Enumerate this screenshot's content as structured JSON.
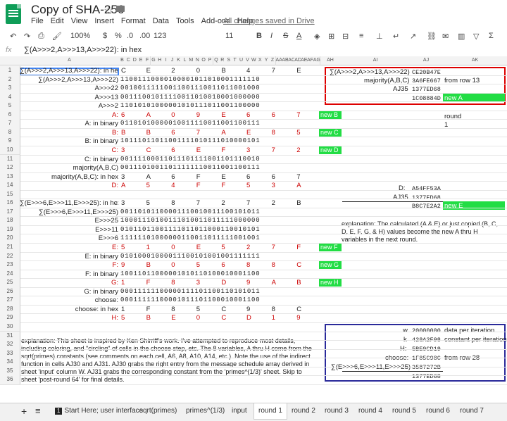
{
  "app": {
    "doc_title": "Copy of SHA-256",
    "menu": [
      "File",
      "Edit",
      "View",
      "Insert",
      "Format",
      "Data",
      "Tools",
      "Add-ons",
      "Help"
    ],
    "saved_status": "All changes saved in Drive"
  },
  "toolbar": {
    "zoom": "100%",
    "currency": "$",
    "percent": "%",
    "dec_less": ".0",
    "dec_more": ".00",
    "format_more": "123",
    "font_size": "11"
  },
  "formula_bar": {
    "fx": "fx",
    "content": "∑(A>>>2,A>>>13,A>>>22): in hex"
  },
  "columns": {
    "a": "A",
    "bits": [
      "B",
      "C",
      "D",
      "E",
      "F",
      "G",
      "H",
      "I",
      "J",
      "K",
      "L",
      "M",
      "N",
      "O",
      "P",
      "Q",
      "R",
      "S",
      "T",
      "U",
      "V",
      "W",
      "X",
      "Y",
      "Z",
      "AA",
      "AB",
      "AC",
      "AD",
      "AE",
      "AF",
      "AG"
    ],
    "ah": "AH",
    "ai": "AI",
    "aj": "AJ",
    "ak": "AK"
  },
  "rows": [
    {
      "n": "1",
      "label": "∑(A>>>2,A>>>13,A>>>22): in hex",
      "hex": [
        "C",
        "",
        "E",
        "",
        "2",
        "",
        "0",
        "",
        "B",
        "",
        "4",
        "",
        "7",
        "",
        "E"
      ]
    },
    {
      "n": "2",
      "label": "∑(A>>>2,A>>>13,A>>>22)",
      "bits": "11001110000100001011010001111110"
    },
    {
      "n": "3",
      "label": "A>>>22",
      "bits": "00100111110011001110011011001000"
    },
    {
      "n": "4",
      "label": "A>>>13",
      "bits": "00111001011110011010010001000000"
    },
    {
      "n": "5",
      "label": "A>>>2",
      "bits": "11010101000001010111011001100000"
    },
    {
      "n": "6",
      "label": "A:",
      "red": true,
      "hex": [
        "6",
        "",
        "A",
        "",
        "0",
        "",
        "9",
        "",
        "E",
        "",
        "6",
        "",
        "6",
        "",
        "7"
      ],
      "green": "new B"
    },
    {
      "n": "7",
      "label": "A: in binary",
      "bits": "01101010000010011110011001100111"
    },
    {
      "n": "8",
      "label": "B:",
      "red": true,
      "hex": [
        "B",
        "",
        "B",
        "",
        "6",
        "",
        "7",
        "",
        "A",
        "",
        "E",
        "",
        "8",
        "",
        "5"
      ],
      "green": "new C"
    },
    {
      "n": "9",
      "label": "B: in binary",
      "bits": "10111011011001111010111010000101"
    },
    {
      "n": "10",
      "label": "C:",
      "red": true,
      "hex": [
        "3",
        "",
        "C",
        "",
        "6",
        "",
        "E",
        "",
        "F",
        "",
        "3",
        "",
        "7",
        "",
        "2"
      ],
      "green": "new D"
    },
    {
      "n": "11",
      "label": "C: in binary",
      "bits": "00111100011011101111001101110010"
    },
    {
      "n": "12",
      "label": "majority(A,B,C)",
      "bits": "00111010011011111110011001100111"
    },
    {
      "n": "13",
      "label": "majority(A,B,C): in hex",
      "hex": [
        "3",
        "",
        "A",
        "",
        "6",
        "",
        "F",
        "",
        "E",
        "",
        "6",
        "",
        "6",
        "",
        "7"
      ]
    },
    {
      "n": "14",
      "label": "D:",
      "red": true,
      "hex": [
        "A",
        "",
        "5",
        "",
        "4",
        "",
        "F",
        "",
        "F",
        "",
        "5",
        "",
        "3",
        "",
        "A"
      ]
    },
    {
      "n": "15",
      "label": "",
      "bits": ""
    },
    {
      "n": "16",
      "label": "∑(E>>>6,E>>>11,E>>>25): in hex",
      "hex": [
        "3",
        "",
        "5",
        "",
        "8",
        "",
        "7",
        "",
        "2",
        "",
        "7",
        "",
        "2",
        "",
        "B"
      ]
    },
    {
      "n": "17",
      "label": "∑(E>>>6,E>>>11,E>>>25)",
      "bits": "00110101100001110010011100101011"
    },
    {
      "n": "18",
      "label": "E>>>25",
      "bits": "10001110100111010011011111000000"
    },
    {
      "n": "19",
      "label": "E>>>11",
      "bits": "01011011001111011011000110010101"
    },
    {
      "n": "20",
      "label": "E>>>6",
      "bits": "11111101000000110011011111001001"
    },
    {
      "n": "21",
      "label": "E:",
      "red": true,
      "hex": [
        "5",
        "",
        "1",
        "",
        "0",
        "",
        "E",
        "",
        "5",
        "",
        "2",
        "",
        "7",
        "",
        "F"
      ],
      "green": "new F"
    },
    {
      "n": "22",
      "label": "E: in binary",
      "bits": "01010001000011100101001001111111"
    },
    {
      "n": "23",
      "label": "F:",
      "red": true,
      "hex": [
        "9",
        "",
        "B",
        "",
        "0",
        "",
        "5",
        "",
        "6",
        "",
        "8",
        "",
        "8",
        "",
        "C"
      ],
      "green": "new G"
    },
    {
      "n": "24",
      "label": "F: in binary",
      "bits": "10011011000001010110100010001100"
    },
    {
      "n": "25",
      "label": "G:",
      "red": true,
      "hex": [
        "1",
        "",
        "F",
        "",
        "8",
        "",
        "3",
        "",
        "D",
        "",
        "9",
        "",
        "A",
        "",
        "B"
      ],
      "green": "new H"
    },
    {
      "n": "26",
      "label": "G: in binary",
      "bits": "00011111100000111101100110101011"
    },
    {
      "n": "27",
      "label": "choose:",
      "bits": "00011111100001011101100010001100"
    },
    {
      "n": "28",
      "label": "choose: in hex",
      "hex": [
        "1",
        "",
        "F",
        "",
        "8",
        "",
        "5",
        "",
        "C",
        "",
        "9",
        "",
        "8",
        "",
        "C"
      ]
    },
    {
      "n": "29",
      "label": "H:",
      "red": true,
      "hex": [
        "5",
        "",
        "B",
        "",
        "E",
        "",
        "0",
        "",
        "C",
        "",
        "D",
        "",
        "1",
        "",
        "9"
      ]
    },
    {
      "n": "30",
      "label": ""
    },
    {
      "n": "31",
      "label": ""
    },
    {
      "n": "32",
      "label": ""
    },
    {
      "n": "33",
      "label": ""
    },
    {
      "n": "34",
      "label": ""
    },
    {
      "n": "35",
      "label": ""
    },
    {
      "n": "36",
      "label": ""
    }
  ],
  "right_panel": {
    "r1_label": "∑(A>>>2,A>>>13,A>>>22)",
    "r1_val": "CE20B47E",
    "r2_label": "majority(A,B,C)",
    "r2_val": "3A6FE667",
    "r2_note": "from row 13",
    "r3_label": "AJ35",
    "r3_val": "1377ED68",
    "r4_val": "1C08884D",
    "r4_note": "new A",
    "r6_note": "round",
    "r7_note": "1",
    "r14_label": "D:",
    "r14_val": "A54FF53A",
    "r15_label": "AJ35",
    "r15_val": "1377ED68",
    "r16_val": "B8C7E2A2",
    "r16_note": "new E",
    "explanation2": "explanation:  The calculated (A & E) or just copied (B, C, D, E, F, G, & H) values become the new A thru H variables in the next round.",
    "r31_label": "w",
    "r31_val": "20000000",
    "r31_note": "data per iteration",
    "r32_label": "k",
    "r32_val": "428A2F98",
    "r32_note": "constant per iteration",
    "r33_label": "H:",
    "r33_val": "5BE0CD19",
    "r34_label": "choose:",
    "r34_val": "1F85C98C",
    "r34_note": "from row 28",
    "r35_label": "∑(E>>>6,E>>>11,E>>>25)",
    "r35_val": "3587272B",
    "r36_val": "1377ED68"
  },
  "explanation1": "explanation:  This sheet is inspired by Ken Shirriff's work.  I've attempted to reproduce most details, including coloring, and \"circling\" of cells in the choose step, etc.  The 8 variables, A thru H come from the sqrt(primes) constants (see comments on each cell, A6, A8, A10, A14, etc.).  Note the use of the indirect function in cells AJ30 and AJ31.  AJ30 grabs the right entry from the message schedule array derived in sheet 'input' column W.  AJ31 grabs the corresponding constant from the 'primes^(1/3)' sheet.  Skip to sheet 'post-round 64' for final details.",
  "tabs": {
    "add": "+",
    "list": "≡",
    "items": [
      "Start Here; user interface",
      "sqrt(primes)",
      "primes^(1/3)",
      "input",
      "round 1",
      "round 2",
      "round 3",
      "round 4",
      "round 5",
      "round 6",
      "round 7"
    ],
    "active": "round 1",
    "first_badge": "1"
  },
  "colors": {
    "accent_red": "#cc0000",
    "new_green": "#22dd44",
    "box_red": "#dd0000",
    "box_blue": "#2a2a9a"
  }
}
